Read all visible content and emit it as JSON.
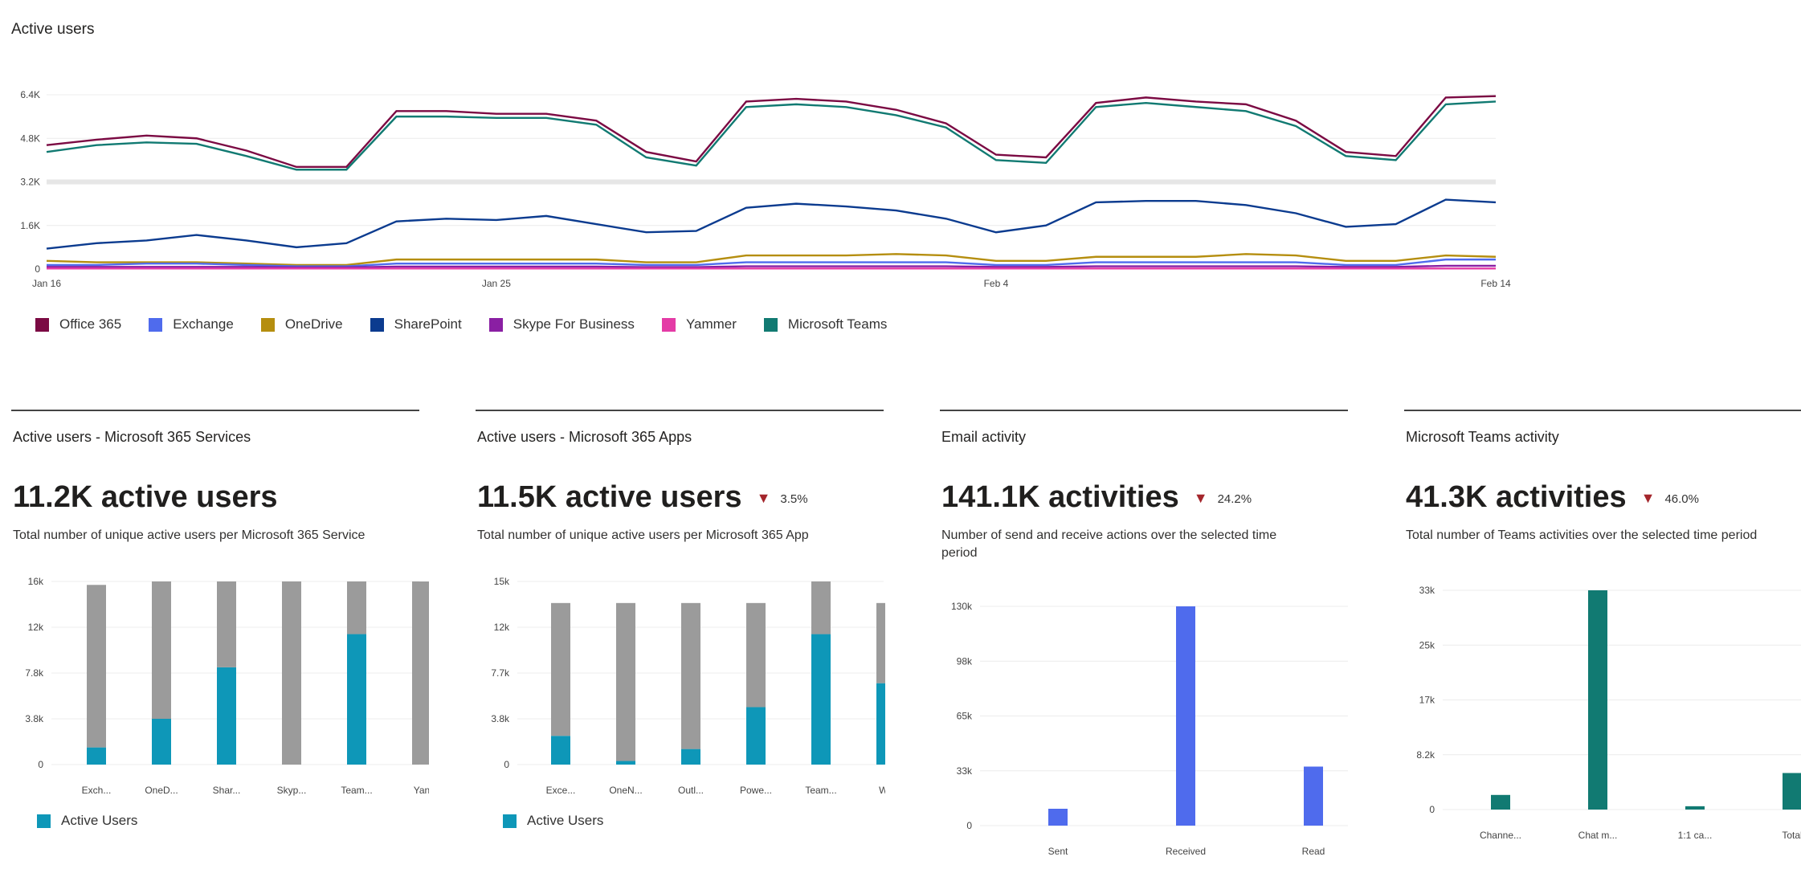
{
  "top": {
    "title": "Active users",
    "legend": [
      {
        "label": "Office 365",
        "color": "#7b0a43"
      },
      {
        "label": "Exchange",
        "color": "#4f6bed"
      },
      {
        "label": "OneDrive",
        "color": "#b58e0f"
      },
      {
        "label": "SharePoint",
        "color": "#0b3b8f"
      },
      {
        "label": "Skype For Business",
        "color": "#8a1fa3"
      },
      {
        "label": "Yammer",
        "color": "#e43ba6"
      },
      {
        "label": "Microsoft Teams",
        "color": "#117a72"
      }
    ]
  },
  "cards": [
    {
      "title": "Active users - Microsoft 365 Services",
      "big": "11.2K active users",
      "trend": "",
      "desc": "Total number of unique active users per Microsoft 365 Service",
      "desc2": "",
      "legend": "Active Users"
    },
    {
      "title": "Active users - Microsoft 365 Apps",
      "big": "11.5K active users",
      "trend": "3.5%",
      "desc": "Total number of unique active users per Microsoft 365 App",
      "desc2": "",
      "legend": "Active Users"
    },
    {
      "title": "Email activity",
      "big": "141.1K activities",
      "trend": "24.2%",
      "desc": "Number of send and receive actions over the selected time",
      "desc2": "period",
      "legend": ""
    },
    {
      "title": "Microsoft Teams activity",
      "big": "41.3K activities",
      "trend": "46.0%",
      "desc": "Total number of Teams activities over the selected time period",
      "desc2": "",
      "legend": ""
    }
  ],
  "chart_data": [
    {
      "type": "line",
      "title": "Active users",
      "x": [
        "Jan 16",
        "Jan 17",
        "Jan 18",
        "Jan 19",
        "Jan 20",
        "Jan 21",
        "Jan 22",
        "Jan 23",
        "Jan 24",
        "Jan 25",
        "Jan 26",
        "Jan 27",
        "Jan 28",
        "Jan 29",
        "Jan 30",
        "Jan 31",
        "Feb 1",
        "Feb 2",
        "Feb 3",
        "Feb 4",
        "Feb 5",
        "Feb 6",
        "Feb 7",
        "Feb 8",
        "Feb 9",
        "Feb 10",
        "Feb 11",
        "Feb 12",
        "Feb 13",
        "Feb 14"
      ],
      "xticks": [
        "Jan 16",
        "Jan 25",
        "Feb 4",
        "Feb 14"
      ],
      "yticks": [
        "0",
        "1.6K",
        "3.2K",
        "4.8K",
        "6.4K"
      ],
      "ylim": [
        0,
        6400
      ],
      "series": [
        {
          "name": "Office 365",
          "color": "#7b0a43",
          "values": [
            4550,
            4750,
            4900,
            4800,
            4350,
            3750,
            3750,
            5800,
            5800,
            5700,
            5700,
            5450,
            4300,
            3950,
            6150,
            6250,
            6150,
            5850,
            5350,
            4200,
            4100,
            6100,
            6300,
            6150,
            6050,
            5450,
            4300,
            4150,
            6300,
            6350
          ]
        },
        {
          "name": "Microsoft Teams",
          "color": "#117a72",
          "values": [
            4300,
            4550,
            4650,
            4600,
            4150,
            3650,
            3650,
            5600,
            5600,
            5550,
            5550,
            5300,
            4100,
            3800,
            5950,
            6050,
            5950,
            5650,
            5200,
            4000,
            3900,
            5950,
            6100,
            5950,
            5800,
            5250,
            4150,
            4000,
            6050,
            6150
          ]
        },
        {
          "name": "SharePoint",
          "color": "#0b3b8f",
          "values": [
            750,
            950,
            1050,
            1250,
            1050,
            800,
            950,
            1750,
            1850,
            1800,
            1950,
            1650,
            1350,
            1400,
            2250,
            2400,
            2300,
            2150,
            1850,
            1350,
            1600,
            2450,
            2500,
            2500,
            2350,
            2050,
            1550,
            1650,
            2550,
            2450
          ]
        },
        {
          "name": "OneDrive",
          "color": "#b58e0f",
          "values": [
            300,
            250,
            250,
            250,
            200,
            150,
            150,
            350,
            350,
            350,
            350,
            350,
            250,
            250,
            500,
            500,
            500,
            550,
            500,
            300,
            300,
            450,
            450,
            450,
            550,
            500,
            300,
            300,
            500,
            450
          ]
        },
        {
          "name": "Exchange",
          "color": "#4f6bed",
          "values": [
            150,
            150,
            200,
            200,
            150,
            100,
            100,
            200,
            200,
            200,
            200,
            200,
            150,
            150,
            250,
            250,
            250,
            250,
            250,
            150,
            150,
            250,
            250,
            250,
            250,
            250,
            150,
            150,
            350,
            350
          ]
        },
        {
          "name": "Skype For Business",
          "color": "#8a1fa3",
          "values": [
            80,
            80,
            80,
            80,
            80,
            60,
            60,
            90,
            90,
            90,
            90,
            90,
            70,
            70,
            100,
            100,
            100,
            100,
            100,
            80,
            80,
            100,
            100,
            100,
            100,
            100,
            80,
            80,
            120,
            120
          ]
        },
        {
          "name": "Yammer",
          "color": "#e43ba6",
          "values": [
            20,
            20,
            20,
            20,
            20,
            20,
            20,
            20,
            20,
            20,
            20,
            20,
            20,
            20,
            20,
            20,
            20,
            20,
            20,
            20,
            20,
            20,
            20,
            20,
            20,
            20,
            20,
            20,
            20,
            20
          ]
        }
      ]
    },
    {
      "type": "bar",
      "title": "Active users - Microsoft 365 Services",
      "categories": [
        "Exch...",
        "OneD...",
        "Shar...",
        "Skyp...",
        "Team...",
        "Yan"
      ],
      "yticks": [
        "0",
        "3.8k",
        "7.8k",
        "12k",
        "16k"
      ],
      "ylim": [
        0,
        16000
      ],
      "series": [
        {
          "name": "Active Users",
          "color": "#0e97b8",
          "values": [
            1500,
            4000,
            8500,
            0,
            11400,
            0
          ]
        },
        {
          "name": "",
          "color": "#9b9b9b",
          "values": [
            14200,
            12000,
            7500,
            16000,
            4600,
            16000
          ]
        }
      ]
    },
    {
      "type": "bar",
      "title": "Active users - Microsoft 365 Apps",
      "categories": [
        "Exce...",
        "OneN...",
        "Outl...",
        "Powe...",
        "Team...",
        "Wo"
      ],
      "yticks": [
        "0",
        "3.8k",
        "7.7k",
        "12k",
        "15k"
      ],
      "ylim": [
        0,
        15300
      ],
      "series": [
        {
          "name": "Active Users",
          "color": "#0e97b8",
          "values": [
            2400,
            300,
            1300,
            4800,
            10900,
            6800
          ]
        },
        {
          "name": "",
          "color": "#9b9b9b",
          "values": [
            11100,
            13200,
            12200,
            8700,
            4400,
            6700
          ]
        }
      ]
    },
    {
      "type": "bar",
      "title": "Email activity",
      "categories": [
        "Sent",
        "Received",
        "Read"
      ],
      "yticks": [
        "0",
        "33k",
        "65k",
        "98k",
        "130k"
      ],
      "ylim": [
        0,
        130000
      ],
      "series": [
        {
          "name": "",
          "color": "#4f6bed",
          "values": [
            10000,
            130000,
            35000
          ]
        }
      ]
    },
    {
      "type": "bar",
      "title": "Microsoft Teams activity",
      "categories": [
        "Channe...",
        "Chat m...",
        "1:1 ca...",
        "Total"
      ],
      "yticks": [
        "0",
        "8.2k",
        "17k",
        "25k",
        "33k"
      ],
      "ylim": [
        0,
        33000
      ],
      "series": [
        {
          "name": "",
          "color": "#117a72",
          "values": [
            2200,
            33000,
            500,
            5500
          ]
        }
      ]
    }
  ]
}
